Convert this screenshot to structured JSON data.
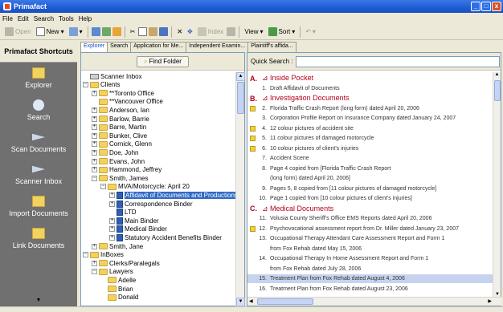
{
  "window": {
    "title": "Primafact",
    "minimize": "_",
    "maximize": "□",
    "close": "x"
  },
  "menu": [
    "File",
    "Edit",
    "Search",
    "Tools",
    "Help"
  ],
  "toolbar": {
    "open": "Open",
    "new": "New",
    "index": "Index",
    "view": "View",
    "sort": "Sort"
  },
  "shortcuts": {
    "header": "Primafact Shortcuts",
    "items": [
      {
        "label": "Explorer",
        "icon": "folder-icon"
      },
      {
        "label": "Search",
        "icon": "search-icon"
      },
      {
        "label": "Scan Documents",
        "icon": "scan-icon"
      },
      {
        "label": "Scanner Inbox",
        "icon": "inbox-icon"
      },
      {
        "label": "Import Documents",
        "icon": "import-icon"
      },
      {
        "label": "Link Documents",
        "icon": "link-icon"
      }
    ],
    "more": "▼"
  },
  "tabs": [
    "Explorer",
    "Search",
    "Application for Me...",
    "Independent Examin...",
    "Plaintiff's affida..."
  ],
  "find_button": "Find Folder",
  "tree": [
    {
      "label": "Scanner Inbox",
      "level": 0,
      "kind": "inbox",
      "exp": ""
    },
    {
      "label": "Clients",
      "level": 0,
      "kind": "folder",
      "exp": "−"
    },
    {
      "label": "**Toronto Office",
      "level": 1,
      "kind": "folder",
      "exp": "+"
    },
    {
      "label": "**Vancouver Office",
      "level": 1,
      "kind": "folder",
      "exp": ""
    },
    {
      "label": "Anderson, Ian",
      "level": 1,
      "kind": "folder",
      "exp": "+"
    },
    {
      "label": "Barlow, Barrie",
      "level": 1,
      "kind": "folder",
      "exp": "+"
    },
    {
      "label": "Barre, Martin",
      "level": 1,
      "kind": "folder",
      "exp": "+"
    },
    {
      "label": "Bunker, Clive",
      "level": 1,
      "kind": "folder",
      "exp": "+"
    },
    {
      "label": "Cornick, Glenn",
      "level": 1,
      "kind": "folder",
      "exp": "+"
    },
    {
      "label": "Doe, John",
      "level": 1,
      "kind": "folder",
      "exp": "+"
    },
    {
      "label": "Evans, John",
      "level": 1,
      "kind": "folder",
      "exp": "+"
    },
    {
      "label": "Hammond, Jeffrey",
      "level": 1,
      "kind": "folder",
      "exp": "+"
    },
    {
      "label": "Smith, James",
      "level": 1,
      "kind": "folder",
      "exp": "−"
    },
    {
      "label": "MVA/Motorcycle:  April 20",
      "level": 2,
      "kind": "folder",
      "exp": "−"
    },
    {
      "label": "Affidavit of Documents and Productions",
      "level": 3,
      "kind": "binder",
      "exp": "+",
      "selected": true
    },
    {
      "label": "Correspondence Binder",
      "level": 3,
      "kind": "binder",
      "exp": "+"
    },
    {
      "label": "LTD",
      "level": 3,
      "kind": "binder",
      "exp": ""
    },
    {
      "label": "Main Binder",
      "level": 3,
      "kind": "binder",
      "exp": "+"
    },
    {
      "label": "Medical Binder",
      "level": 3,
      "kind": "binder",
      "exp": "+"
    },
    {
      "label": "Statutory Accident Benefits Binder",
      "level": 3,
      "kind": "binder",
      "exp": "+"
    },
    {
      "label": "Smith, Jane",
      "level": 1,
      "kind": "folder",
      "exp": "+"
    },
    {
      "label": "InBoxes",
      "level": 0,
      "kind": "folder",
      "exp": "−"
    },
    {
      "label": "Clerks/Paralegals",
      "level": 1,
      "kind": "folder",
      "exp": "+"
    },
    {
      "label": "Lawyers",
      "level": 1,
      "kind": "folder",
      "exp": "−"
    },
    {
      "label": "Adelle",
      "level": 2,
      "kind": "folder",
      "exp": ""
    },
    {
      "label": "Brian",
      "level": 2,
      "kind": "folder",
      "exp": ""
    },
    {
      "label": "Donald",
      "level": 2,
      "kind": "folder",
      "exp": ""
    }
  ],
  "quick_search": {
    "label": "Quick Search :",
    "value": ""
  },
  "documents": [
    {
      "type": "section",
      "letter": "A.",
      "text": "⊿ Inside Pocket"
    },
    {
      "type": "item",
      "num": "1.",
      "text": "Draft Affidavit of Documents",
      "mark": false
    },
    {
      "type": "section",
      "letter": "B.",
      "text": "⊿ Investigation Documents"
    },
    {
      "type": "item",
      "num": "2.",
      "text": "Florida Traffic Crash Report (long form) dated April 20, 2006",
      "mark": true
    },
    {
      "type": "item",
      "num": "3.",
      "text": "Corporation Profile Report on Insurance Company dated January 24, 2007",
      "mark": false
    },
    {
      "type": "item",
      "num": "4.",
      "text": "12 colour pictures of accident site",
      "mark": true
    },
    {
      "type": "item",
      "num": "5.",
      "text": "11 colour pictures of damaged motorcycle",
      "mark": true
    },
    {
      "type": "item",
      "num": "6.",
      "text": "10 colour pictures of client's injuries",
      "mark": true
    },
    {
      "type": "item",
      "num": "7.",
      "text": "Accident Scene",
      "mark": false
    },
    {
      "type": "item",
      "num": "8.",
      "text": "Page 4 copied from [Florida Traffic Crash Report",
      "mark": false
    },
    {
      "type": "item",
      "num": "",
      "text": "(long form) dated April 20, 2006]",
      "mark": false
    },
    {
      "type": "item",
      "num": "9.",
      "text": "Pages 5, 8 copied from [11 colour pictures of damaged motorcycle]",
      "mark": false
    },
    {
      "type": "item",
      "num": "10.",
      "text": "Page 1 copied from [10 colour pictures of client's injuries]",
      "mark": false
    },
    {
      "type": "section",
      "letter": "C.",
      "text": "⊿ Medical Documents"
    },
    {
      "type": "item",
      "num": "11.",
      "text": "Volusia County Sheriff's Office EMS Reports dated April 20, 2006",
      "mark": false
    },
    {
      "type": "item",
      "num": "12.",
      "text": "Psychovocational assessment report from Dr. Miller dated January 23, 2007",
      "mark": true
    },
    {
      "type": "item",
      "num": "13.",
      "text": "Occupational Therapy Attendant Care Assessment Report and Form 1",
      "mark": false
    },
    {
      "type": "item",
      "num": "",
      "text": "from Fox Rehab dated May 15, 2006",
      "mark": false
    },
    {
      "type": "item",
      "num": "14.",
      "text": "Occupational Therapy In Home Assessment Report and Form 1",
      "mark": false
    },
    {
      "type": "item",
      "num": "",
      "text": "from Fox Rehab dated July 28, 2006",
      "mark": false
    },
    {
      "type": "item",
      "num": "15.",
      "text": "Treatment Plan from Fox Rehab dated August 4, 2006",
      "mark": false,
      "highlight": true
    },
    {
      "type": "item",
      "num": "16.",
      "text": "Treatment Plan from Fox Rehab dated August 23, 2006",
      "mark": false
    }
  ],
  "colors": {
    "title_blue": "#1f5bd3",
    "section_red": "#b3001b",
    "selection": "#316ac5",
    "shortcut_bg": "#707070"
  }
}
